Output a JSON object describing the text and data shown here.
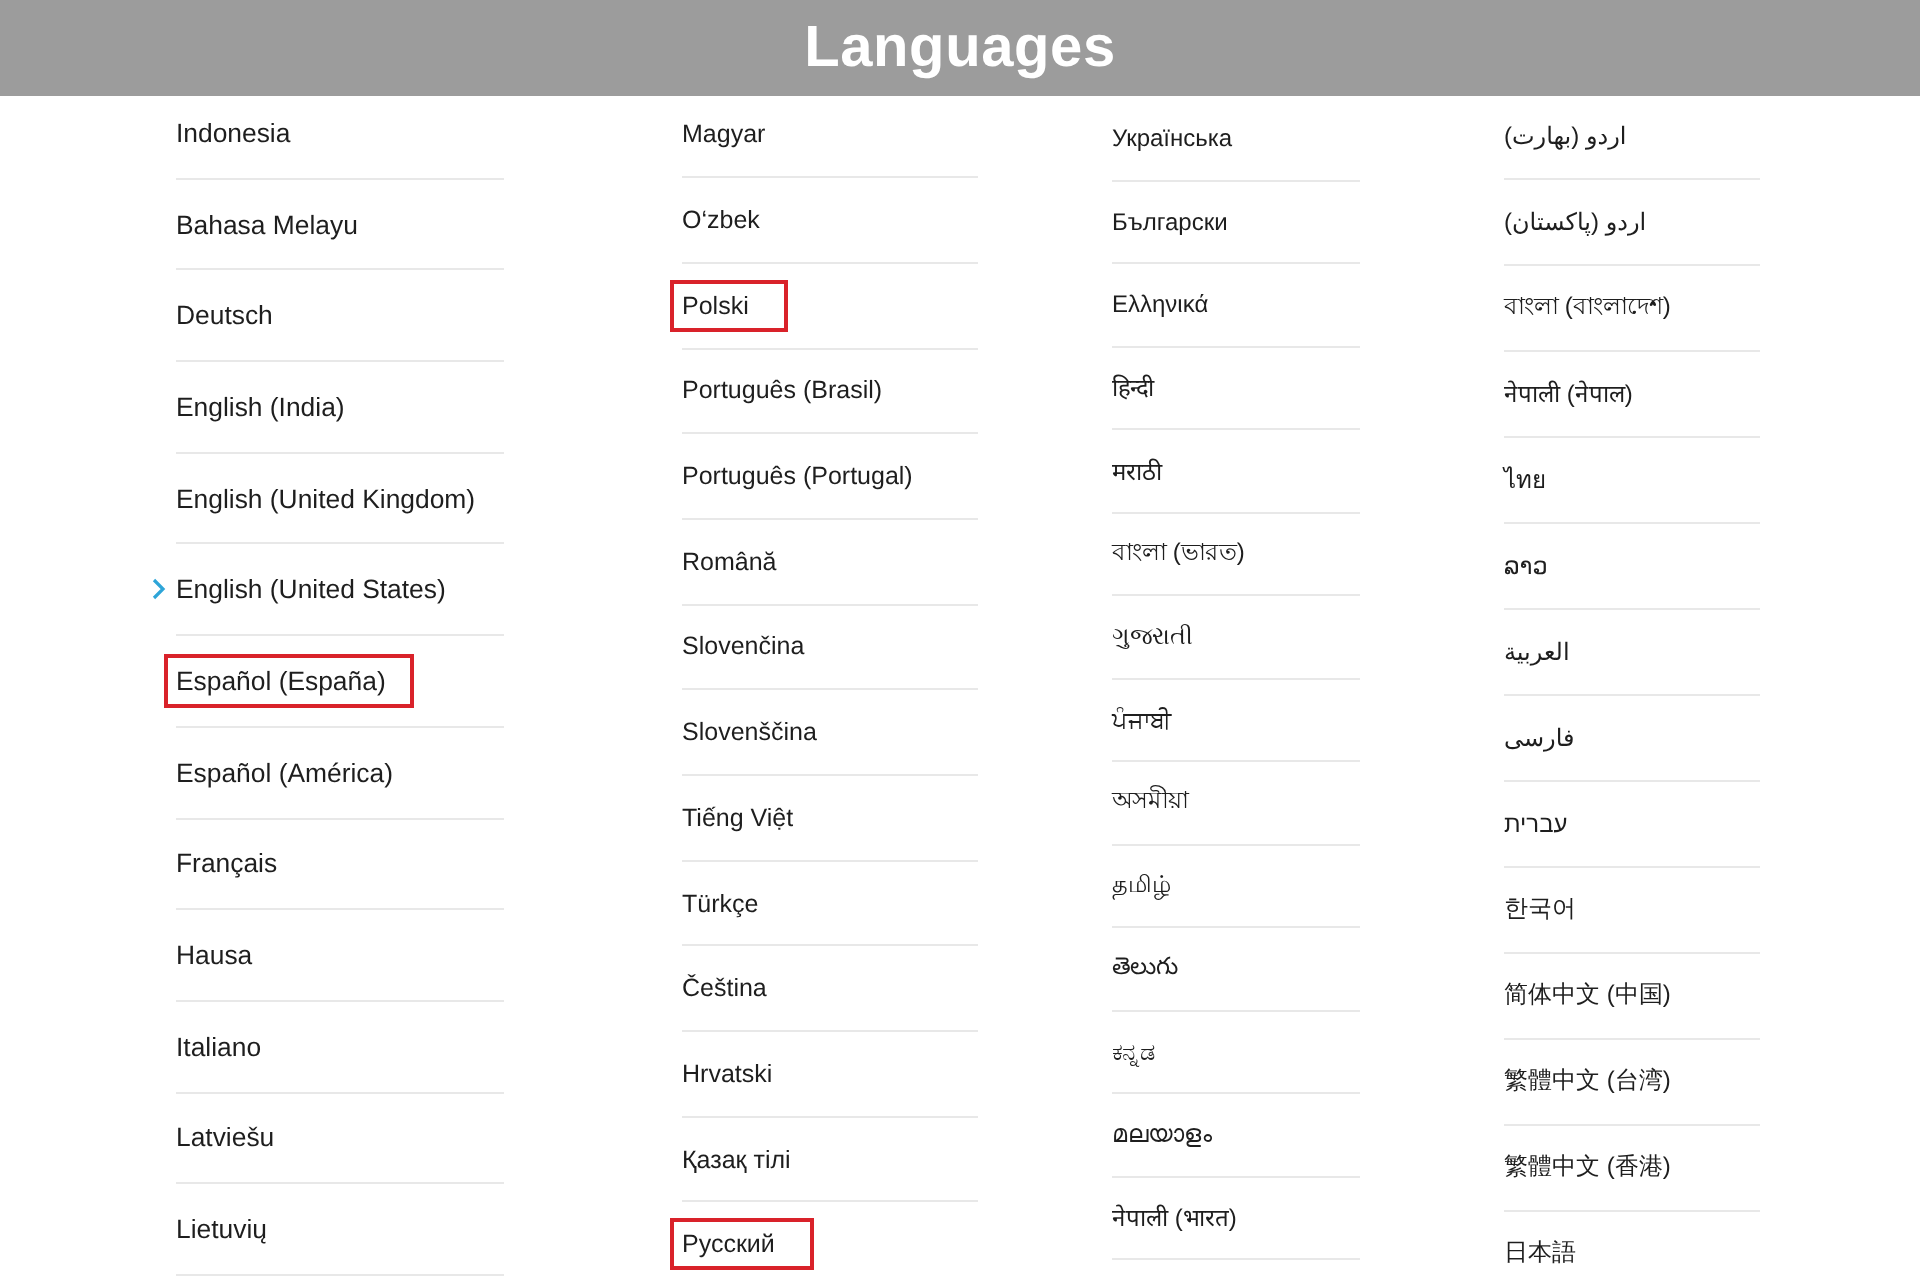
{
  "header": {
    "title": "Languages"
  },
  "columns": [
    {
      "items": [
        {
          "label": "Indonesia",
          "selected": false,
          "highlighted": false
        },
        {
          "label": "Bahasa Melayu",
          "selected": false,
          "highlighted": false
        },
        {
          "label": "Deutsch",
          "selected": false,
          "highlighted": false
        },
        {
          "label": "English (India)",
          "selected": false,
          "highlighted": false
        },
        {
          "label": "English (United Kingdom)",
          "selected": false,
          "highlighted": false
        },
        {
          "label": "English (United States)",
          "selected": true,
          "highlighted": false
        },
        {
          "label": "Español (España)",
          "selected": false,
          "highlighted": true
        },
        {
          "label": "Español (América)",
          "selected": false,
          "highlighted": false
        },
        {
          "label": "Français",
          "selected": false,
          "highlighted": false
        },
        {
          "label": "Hausa",
          "selected": false,
          "highlighted": false
        },
        {
          "label": "Italiano",
          "selected": false,
          "highlighted": false
        },
        {
          "label": "Latviešu",
          "selected": false,
          "highlighted": false
        },
        {
          "label": "Lietuvių",
          "selected": false,
          "highlighted": false
        }
      ]
    },
    {
      "items": [
        {
          "label": "Magyar",
          "selected": false,
          "highlighted": false
        },
        {
          "label": "O‘zbek",
          "selected": false,
          "highlighted": false
        },
        {
          "label": "Polski",
          "selected": false,
          "highlighted": true
        },
        {
          "label": "Português (Brasil)",
          "selected": false,
          "highlighted": false
        },
        {
          "label": "Português (Portugal)",
          "selected": false,
          "highlighted": false
        },
        {
          "label": "Română",
          "selected": false,
          "highlighted": false
        },
        {
          "label": "Slovenčina",
          "selected": false,
          "highlighted": false
        },
        {
          "label": "Slovenščina",
          "selected": false,
          "highlighted": false
        },
        {
          "label": "Tiếng Việt",
          "selected": false,
          "highlighted": false
        },
        {
          "label": "Türkçe",
          "selected": false,
          "highlighted": false
        },
        {
          "label": "Čeština",
          "selected": false,
          "highlighted": false
        },
        {
          "label": "Hrvatski",
          "selected": false,
          "highlighted": false
        },
        {
          "label": "Қазақ тілі",
          "selected": false,
          "highlighted": false
        },
        {
          "label": "Русский",
          "selected": false,
          "highlighted": true
        }
      ]
    },
    {
      "items": [
        {
          "label": "Українська",
          "selected": false,
          "highlighted": false
        },
        {
          "label": "Български",
          "selected": false,
          "highlighted": false
        },
        {
          "label": "Ελληνικά",
          "selected": false,
          "highlighted": false
        },
        {
          "label": "हिन्दी",
          "selected": false,
          "highlighted": false
        },
        {
          "label": "मराठी",
          "selected": false,
          "highlighted": false
        },
        {
          "label": "বাংলা (ভারত)",
          "selected": false,
          "highlighted": false
        },
        {
          "label": "ગુજરાતી",
          "selected": false,
          "highlighted": false
        },
        {
          "label": "ਪੰਜਾਬੀ",
          "selected": false,
          "highlighted": false
        },
        {
          "label": "অসমীয়া",
          "selected": false,
          "highlighted": false
        },
        {
          "label": "தமிழ்",
          "selected": false,
          "highlighted": false
        },
        {
          "label": "తెలుగు",
          "selected": false,
          "highlighted": false
        },
        {
          "label": "ಕನ್ನಡ",
          "selected": false,
          "highlighted": false
        },
        {
          "label": "മലയാളം",
          "selected": false,
          "highlighted": false
        },
        {
          "label": "नेपाली (भारत)",
          "selected": false,
          "highlighted": false
        }
      ]
    },
    {
      "items": [
        {
          "label": "اردو (بھارت)",
          "selected": false,
          "highlighted": false
        },
        {
          "label": "اردو (پاکستان)",
          "selected": false,
          "highlighted": false
        },
        {
          "label": "বাংলা (বাংলাদেশ)",
          "selected": false,
          "highlighted": false
        },
        {
          "label": "नेपाली (नेपाल)",
          "selected": false,
          "highlighted": false
        },
        {
          "label": "ไทย",
          "selected": false,
          "highlighted": false
        },
        {
          "label": "ລາວ",
          "selected": false,
          "highlighted": false
        },
        {
          "label": "العربية",
          "selected": false,
          "highlighted": false
        },
        {
          "label": "فارسی",
          "selected": false,
          "highlighted": false
        },
        {
          "label": "עברית",
          "selected": false,
          "highlighted": false
        },
        {
          "label": "한국어",
          "selected": false,
          "highlighted": false
        },
        {
          "label": "简体中文 (中国)",
          "selected": false,
          "highlighted": false
        },
        {
          "label": "繁體中文 (台湾)",
          "selected": false,
          "highlighted": false
        },
        {
          "label": "繁體中文 (香港)",
          "selected": false,
          "highlighted": false
        },
        {
          "label": "日本語",
          "selected": false,
          "highlighted": false
        }
      ]
    }
  ]
}
